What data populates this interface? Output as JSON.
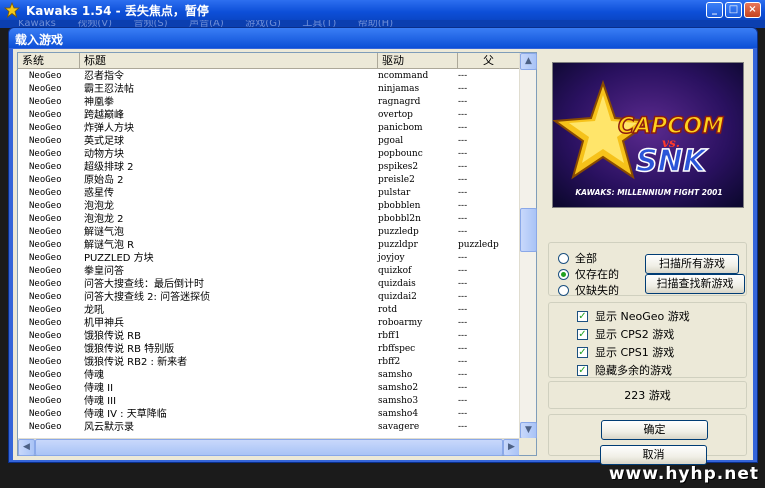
{
  "window": {
    "title": "Kawaks 1.54 - 丢失焦点，暂停",
    "buttons": {
      "minimize": "_",
      "maximize": "□",
      "close": "×"
    }
  },
  "menu": [
    "Kawaks",
    "视频(V)",
    "音频(S)",
    "声音(A)",
    "游戏(G)",
    "工具(T)",
    "帮助(H)"
  ],
  "dialog": {
    "title": "载入游戏",
    "columns": {
      "system": "系统",
      "title": "标题",
      "driver": "驱动",
      "parent": "父"
    },
    "rows": [
      {
        "system": "NeoGeo",
        "title": "忍者指令",
        "driver": "ncommand",
        "parent": "---"
      },
      {
        "system": "NeoGeo",
        "title": "霸王忍法帖",
        "driver": "ninjamas",
        "parent": "---"
      },
      {
        "system": "NeoGeo",
        "title": "神凰拳",
        "driver": "ragnagrd",
        "parent": "---"
      },
      {
        "system": "NeoGeo",
        "title": "跨越巅峰",
        "driver": "overtop",
        "parent": "---"
      },
      {
        "system": "NeoGeo",
        "title": "炸弹人方块",
        "driver": "panicbom",
        "parent": "---"
      },
      {
        "system": "NeoGeo",
        "title": "英式足球",
        "driver": "pgoal",
        "parent": "---"
      },
      {
        "system": "NeoGeo",
        "title": "动物方块",
        "driver": "popbounc",
        "parent": "---"
      },
      {
        "system": "NeoGeo",
        "title": "超级排球 2",
        "driver": "pspikes2",
        "parent": "---"
      },
      {
        "system": "NeoGeo",
        "title": "原始岛 2",
        "driver": "preisle2",
        "parent": "---"
      },
      {
        "system": "NeoGeo",
        "title": "惑星传",
        "driver": "pulstar",
        "parent": "---"
      },
      {
        "system": "NeoGeo",
        "title": "泡泡龙",
        "driver": "pbobblen",
        "parent": "---"
      },
      {
        "system": "NeoGeo",
        "title": "泡泡龙 2",
        "driver": "pbobbl2n",
        "parent": "---"
      },
      {
        "system": "NeoGeo",
        "title": "解谜气泡",
        "driver": "puzzledp",
        "parent": "---"
      },
      {
        "system": "NeoGeo",
        "title": "解谜气泡 R",
        "driver": "puzzldpr",
        "parent": "puzzledp"
      },
      {
        "system": "NeoGeo",
        "title": "PUZZLED 方块",
        "driver": "joyjoy",
        "parent": "---"
      },
      {
        "system": "NeoGeo",
        "title": "拳皇问答",
        "driver": "quizkof",
        "parent": "---"
      },
      {
        "system": "NeoGeo",
        "title": "问答大搜查线：最后倒计时",
        "driver": "quizdais",
        "parent": "---"
      },
      {
        "system": "NeoGeo",
        "title": "问答大搜查线 2: 问答迷探侦",
        "driver": "quizdai2",
        "parent": "---"
      },
      {
        "system": "NeoGeo",
        "title": "龙吼",
        "driver": "rotd",
        "parent": "---"
      },
      {
        "system": "NeoGeo",
        "title": "机甲神兵",
        "driver": "roboarmy",
        "parent": "---"
      },
      {
        "system": "NeoGeo",
        "title": "饿狼传说 RB",
        "driver": "rbff1",
        "parent": "---"
      },
      {
        "system": "NeoGeo",
        "title": "饿狼传说 RB 特别版",
        "driver": "rbffspec",
        "parent": "---"
      },
      {
        "system": "NeoGeo",
        "title": "饿狼传说 RB2 : 新来者",
        "driver": "rbff2",
        "parent": "---"
      },
      {
        "system": "NeoGeo",
        "title": "侍魂",
        "driver": "samsho",
        "parent": "---"
      },
      {
        "system": "NeoGeo",
        "title": "侍魂 II",
        "driver": "samsho2",
        "parent": "---"
      },
      {
        "system": "NeoGeo",
        "title": "侍魂 III",
        "driver": "samsho3",
        "parent": "---"
      },
      {
        "system": "NeoGeo",
        "title": "侍魂 IV : 天草降临",
        "driver": "samsho4",
        "parent": "---"
      },
      {
        "system": "NeoGeo",
        "title": "风云默示录",
        "driver": "savagere",
        "parent": "---"
      }
    ],
    "preview": {
      "capcom": "CAPCOM",
      "vs": "vs.",
      "snk": "SNK",
      "subtitle": "KAWAKS: MILLENNIUM FIGHT 2001"
    },
    "filter": {
      "options": [
        {
          "label": "全部",
          "selected": false
        },
        {
          "label": "仅存在的",
          "selected": true
        },
        {
          "label": "仅缺失的",
          "selected": false
        }
      ],
      "scan_all": "扫描所有游戏",
      "scan_new": "扫描查找新游戏"
    },
    "checkboxes": [
      {
        "label": "显示 NeoGeo 游戏",
        "checked": true
      },
      {
        "label": "显示 CPS2 游戏",
        "checked": true
      },
      {
        "label": "显示 CPS1 游戏",
        "checked": true
      },
      {
        "label": "隐藏多余的游戏",
        "checked": true
      }
    ],
    "game_count": "223 游戏",
    "ok": "确定",
    "cancel": "取消"
  },
  "watermark": "www.hyhp.net",
  "colors": {
    "titlebar": "#0d4fd8",
    "dialog_bg": "#ece9d8",
    "accent_green": "#21a121"
  }
}
